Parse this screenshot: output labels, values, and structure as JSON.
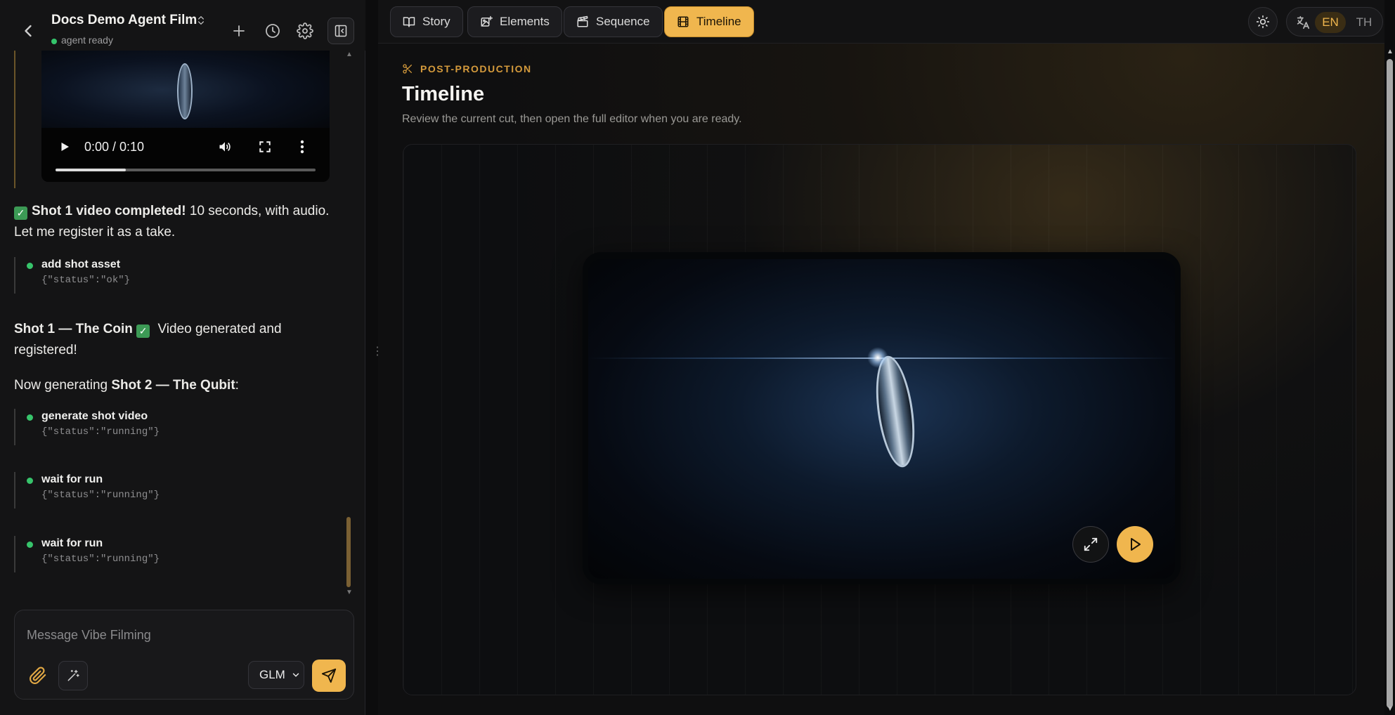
{
  "header": {
    "project_title": "Docs Demo Agent Film",
    "status": "agent ready"
  },
  "video_player": {
    "time": "0:00 / 0:10",
    "progress": 0.27
  },
  "messages": {
    "shot1_done_bold": "Shot 1 video completed!",
    "shot1_done_rest": " 10 seconds, with audio. Let me register it as a take.",
    "shot1_summary_bold": "Shot 1 — The Coin",
    "shot1_summary_rest": " Video generated and registered!",
    "now_generating_prefix": "Now generating ",
    "now_generating_bold": "Shot 2 — The Qubit",
    "now_generating_suffix": ":"
  },
  "tools": [
    {
      "name": "add shot asset",
      "result": "{\"status\":\"ok\"}"
    },
    {
      "name": "generate shot video",
      "result": "{\"status\":\"running\"}"
    },
    {
      "name": "wait for run",
      "result": "{\"status\":\"running\"}"
    },
    {
      "name": "wait for run",
      "result": "{\"status\":\"running\"}"
    }
  ],
  "composer": {
    "placeholder": "Message Vibe Filming",
    "model": "GLM"
  },
  "tabs": [
    {
      "label": "Story",
      "icon": "book-icon"
    },
    {
      "label": "Elements",
      "icon": "image-plus-icon"
    },
    {
      "label": "Sequence",
      "icon": "clapperboard-icon"
    },
    {
      "label": "Timeline",
      "icon": "film-icon",
      "active": true
    }
  ],
  "language": {
    "en": "EN",
    "th": "TH",
    "selected": "EN"
  },
  "page": {
    "kicker": "POST-PRODUCTION",
    "title": "Timeline",
    "subtitle": "Review the current cut, then open the full editor when you are ready."
  },
  "colors": {
    "accent": "#f0b64e",
    "status_ok": "#34c46b"
  }
}
